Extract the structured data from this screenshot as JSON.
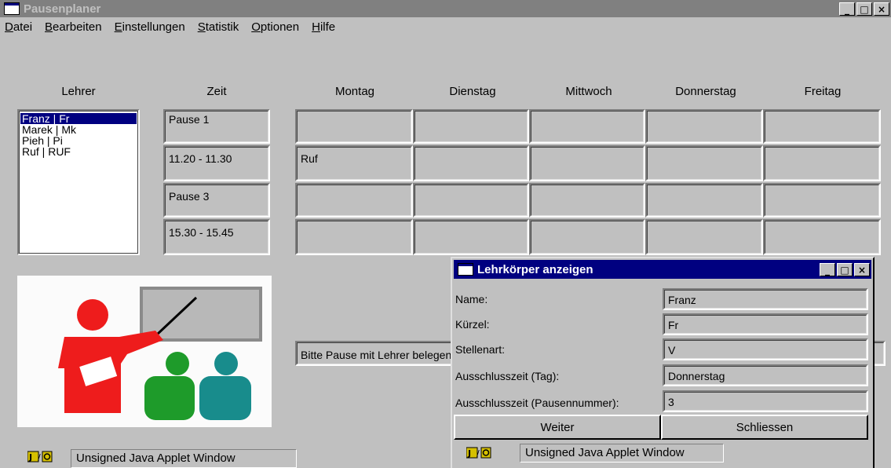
{
  "window": {
    "title": "Pausenplaner",
    "minimize_glyph": "_",
    "maximize_glyph": "□",
    "close_glyph": "×"
  },
  "menu": [
    {
      "mnemonic": "D",
      "rest": "atei"
    },
    {
      "mnemonic": "B",
      "rest": "earbeiten"
    },
    {
      "mnemonic": "E",
      "rest": "instellungen"
    },
    {
      "mnemonic": "S",
      "rest": "tatistik"
    },
    {
      "mnemonic": "O",
      "rest": "ptionen"
    },
    {
      "mnemonic": "H",
      "rest": "ilfe"
    }
  ],
  "headers": {
    "teacher": "Lehrer",
    "time": "Zeit",
    "days": [
      "Montag",
      "Dienstag",
      "Mittwoch",
      "Donnerstag",
      "Freitag"
    ]
  },
  "teachers": [
    "Franz | Fr",
    "Marek | Mk",
    "Pieh | Pi",
    "Ruf | RUF"
  ],
  "times": [
    "Pause 1",
    "11.20 - 11.30",
    "Pause 3",
    "15.30 - 15.45"
  ],
  "schedule": [
    [
      "",
      "",
      "",
      "",
      ""
    ],
    [
      "Ruf",
      "",
      "",
      "",
      ""
    ],
    [
      "",
      "",
      "",
      "",
      ""
    ],
    [
      "",
      "",
      "",
      "",
      ""
    ]
  ],
  "message_field": "Bitte Pause mit Lehrer belegen",
  "status": {
    "text": "Unsigned Java Applet Window"
  },
  "dialog": {
    "title": "Lehrkörper anzeigen",
    "fields": [
      {
        "label": "Name:",
        "value": "Franz"
      },
      {
        "label": "Kürzel:",
        "value": "Fr"
      },
      {
        "label": "Stellenart:",
        "value": "V"
      },
      {
        "label": "Ausschlusszeit (Tag):",
        "value": "Donnerstag"
      },
      {
        "label": "Ausschlusszeit (Pausennummer):",
        "value": "3"
      }
    ],
    "next_button": "Weiter",
    "close_button": "Schliessen",
    "status_text": "Unsigned Java Applet Window"
  },
  "colors": {
    "window_bg": "#c0c0c0",
    "inactive_title": "#808080",
    "active_title": "#000080",
    "selection": "#000080"
  }
}
